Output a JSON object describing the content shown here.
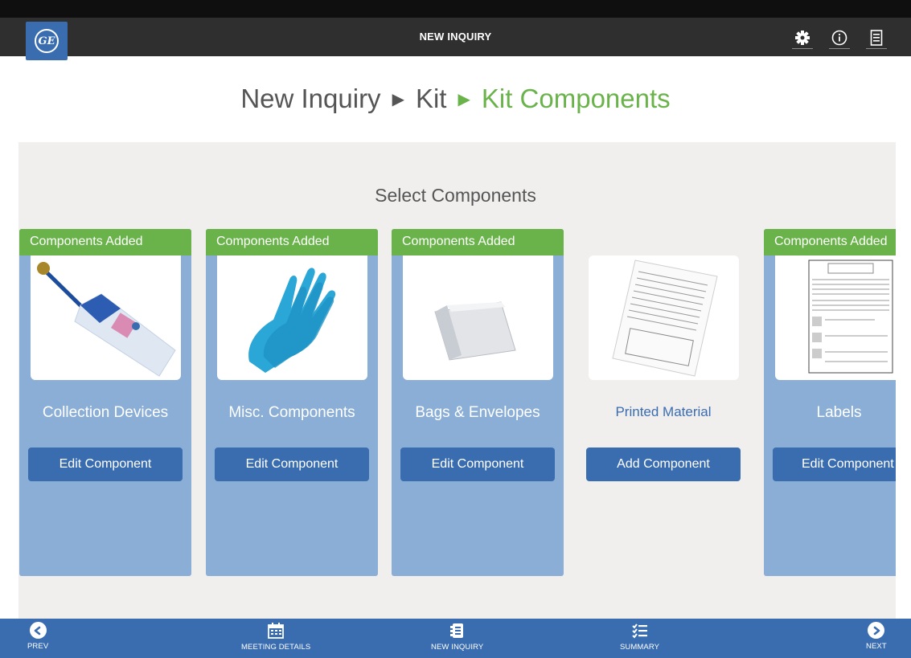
{
  "header": {
    "title": "NEW INQUIRY",
    "logo_text": "GE",
    "icons": [
      "gear-icon",
      "info-icon",
      "list-icon"
    ]
  },
  "breadcrumb": {
    "items": [
      "New Inquiry",
      "Kit",
      "Kit Components"
    ],
    "separator_icon": "triangle-right-icon"
  },
  "main": {
    "section_title": "Select Components",
    "cards": [
      {
        "status": "Components Added",
        "name": "Collection Devices",
        "button": "Edit Component",
        "image": "collection-device-image"
      },
      {
        "status": "Components Added",
        "name": "Misc. Components",
        "button": "Edit Component",
        "image": "gloves-image"
      },
      {
        "status": "Components Added",
        "name": "Bags & Envelopes",
        "button": "Edit Component",
        "image": "foil-bag-image"
      },
      {
        "status": "",
        "name": "Printed Material",
        "button": "Add Component",
        "image": "printed-document-image"
      },
      {
        "status": "Components Added",
        "name": "Labels",
        "button": "Edit Component",
        "image": "label-document-image"
      }
    ]
  },
  "footer": {
    "prev": "PREV",
    "meeting_details": "MEETING DETAILS",
    "new_inquiry": "NEW INQUIRY",
    "summary": "SUMMARY",
    "next": "NEXT"
  },
  "colors": {
    "header_bg": "#2f2f2f",
    "brand_blue": "#3a6db0",
    "card_blue": "#8aaed6",
    "accent_green": "#6ab34a",
    "panel_bg": "#f0efee"
  }
}
